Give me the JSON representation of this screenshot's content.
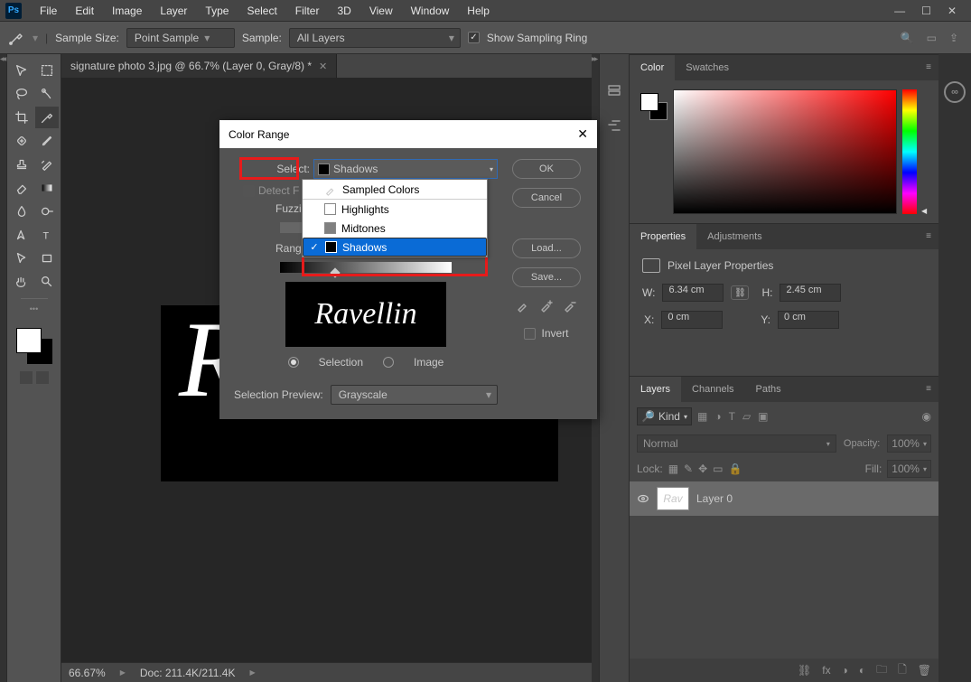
{
  "menu": {
    "file": "File",
    "edit": "Edit",
    "image": "Image",
    "layer": "Layer",
    "type": "Type",
    "select": "Select",
    "filter": "Filter",
    "threeD": "3D",
    "view": "View",
    "window": "Window",
    "help": "Help"
  },
  "ps_logo": "Ps",
  "options": {
    "sampleSizeLabel": "Sample Size:",
    "sampleSizeValue": "Point Sample",
    "sampleLabel": "Sample:",
    "sampleValue": "All Layers",
    "showRing": "Show Sampling Ring"
  },
  "docTab": "signature photo 3.jpg @ 66.7% (Layer 0, Gray/8) *",
  "status": {
    "zoom": "66.67%",
    "doc": "Doc: 211.4K/211.4K"
  },
  "dialog": {
    "title": "Color Range",
    "selectLabel": "Select:",
    "selectValue": "Shadows",
    "detect": "Detect Faces",
    "fuzz": "Fuzziness:",
    "range": "Range:",
    "selectionRadio": "Selection",
    "imageRadio": "Image",
    "previewLabel": "Selection Preview:",
    "previewValue": "Grayscale",
    "invert": "Invert",
    "ok": "OK",
    "cancel": "Cancel",
    "load": "Load...",
    "save": "Save...",
    "previewText": "Ravellin",
    "dropdown": {
      "sampled": "Sampled Colors",
      "highlights": "Highlights",
      "midtones": "Midtones",
      "shadows": "Shadows"
    }
  },
  "panels": {
    "color": "Color",
    "swatches": "Swatches",
    "properties": "Properties",
    "adjustments": "Adjustments",
    "pixelProps": "Pixel Layer Properties",
    "w": "W:",
    "wval": "6.34 cm",
    "h": "H:",
    "hval": "2.45 cm",
    "x": "X:",
    "xval": "0 cm",
    "y": "Y:",
    "yval": "0 cm",
    "layers": "Layers",
    "channels": "Channels",
    "paths": "Paths",
    "kind": "Kind",
    "normal": "Normal",
    "opacity": "Opacity:",
    "opval": "100%",
    "lock": "Lock:",
    "fill": "Fill:",
    "fillval": "100%",
    "layer0": "Layer 0"
  },
  "artText": "Re",
  "cc": "∞"
}
